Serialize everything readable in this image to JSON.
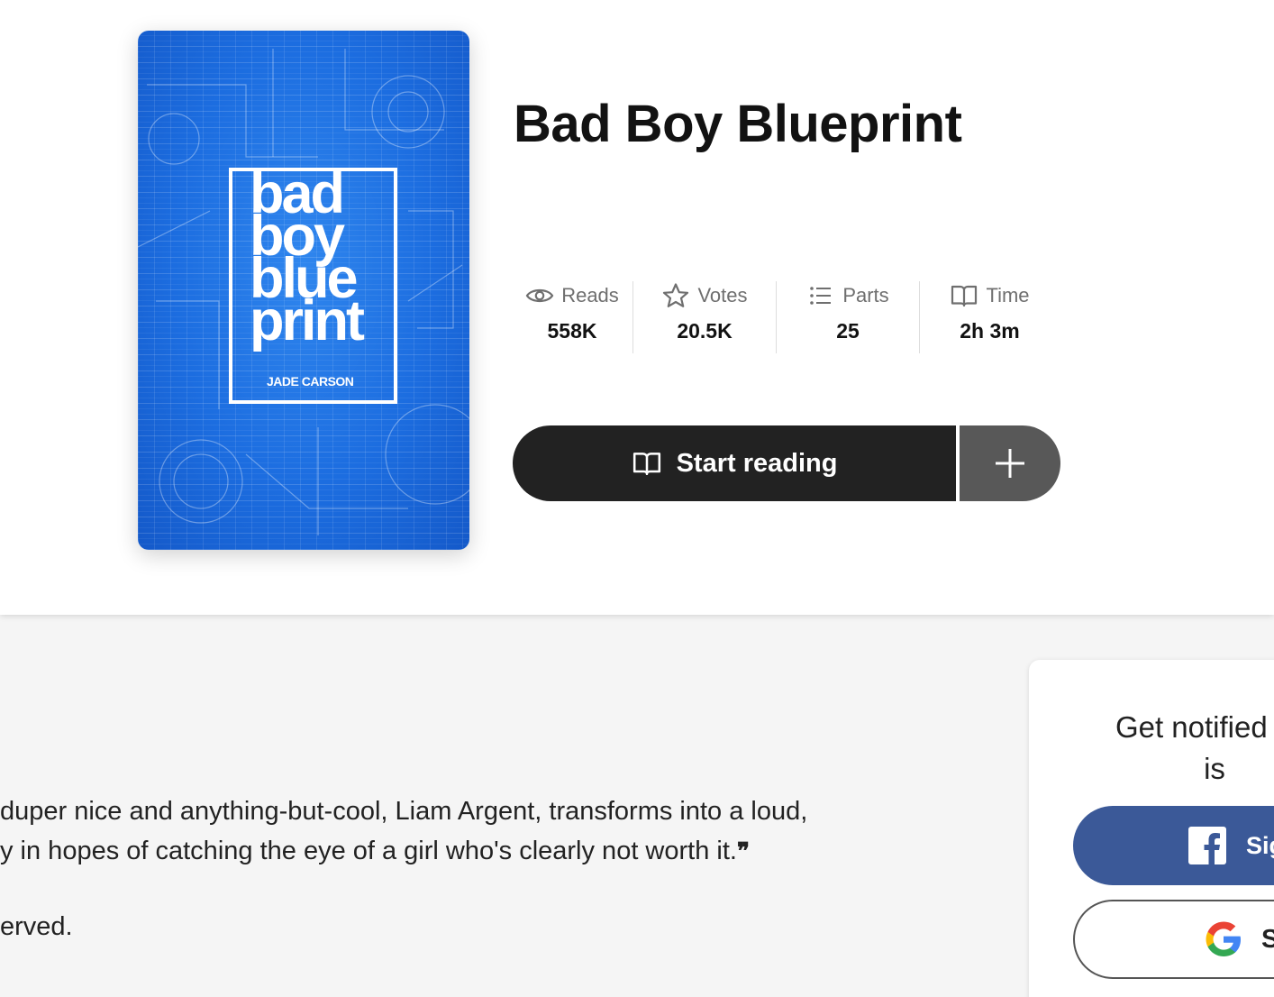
{
  "cover": {
    "title_lines": [
      "bad",
      "boy",
      "blue",
      "print"
    ],
    "author": "JADE CARSON",
    "color": "#1c6de0"
  },
  "story": {
    "title": "Bad Boy Blueprint"
  },
  "stats": [
    {
      "label": "Reads",
      "value": "558K",
      "icon": "eye-icon"
    },
    {
      "label": "Votes",
      "value": "20.5K",
      "icon": "star-icon"
    },
    {
      "label": "Parts",
      "value": "25",
      "icon": "list-icon"
    },
    {
      "label": "Time",
      "value": "2h 3m",
      "icon": "book-icon"
    }
  ],
  "actions": {
    "start_reading": "Start reading",
    "add_icon": "plus-icon"
  },
  "description": {
    "line1": "duper nice and anything-but-cool, Liam Argent, transforms into a loud,",
    "line2": "y in hopes of catching the eye of a girl who's clearly not worth it.",
    "rights": "erved."
  },
  "notify": {
    "line1": "Get notified wh",
    "line2": "is",
    "facebook_label": "Sig",
    "google_label": "S",
    "facebook_color": "#3b5998"
  }
}
